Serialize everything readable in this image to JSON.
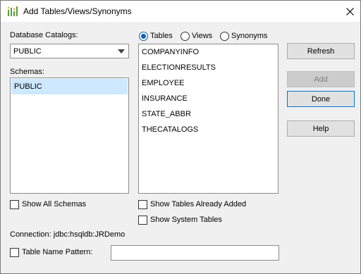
{
  "window": {
    "title": "Add Tables/Views/Synonyms"
  },
  "catalog": {
    "label": "Database Catalogs:",
    "selected": "PUBLIC"
  },
  "schemas": {
    "label": "Schemas:",
    "items": [
      "PUBLIC"
    ]
  },
  "object_types": [
    {
      "label": "Tables",
      "checked": true
    },
    {
      "label": "Views",
      "checked": false
    },
    {
      "label": "Synonyms",
      "checked": false
    }
  ],
  "tables": [
    "COMPANYINFO",
    "ELECTIONRESULTS",
    "EMPLOYEE",
    "INSURANCE",
    "STATE_ABBR",
    "THECATALOGS"
  ],
  "buttons": {
    "refresh": "Refresh",
    "add": "Add",
    "done": "Done",
    "help": "Help"
  },
  "options": {
    "show_all_schemas": "Show All Schemas",
    "show_tables_added": "Show Tables Already Added",
    "show_system_tables": "Show System Tables"
  },
  "connection": "Connection: jdbc:hsqldb:JRDemo",
  "pattern": {
    "label": "Table Name Pattern:",
    "value": ""
  },
  "colors": {
    "selection": "#cde8ff",
    "accent": "#0078d7",
    "app_icon": "#5a9e3a"
  }
}
